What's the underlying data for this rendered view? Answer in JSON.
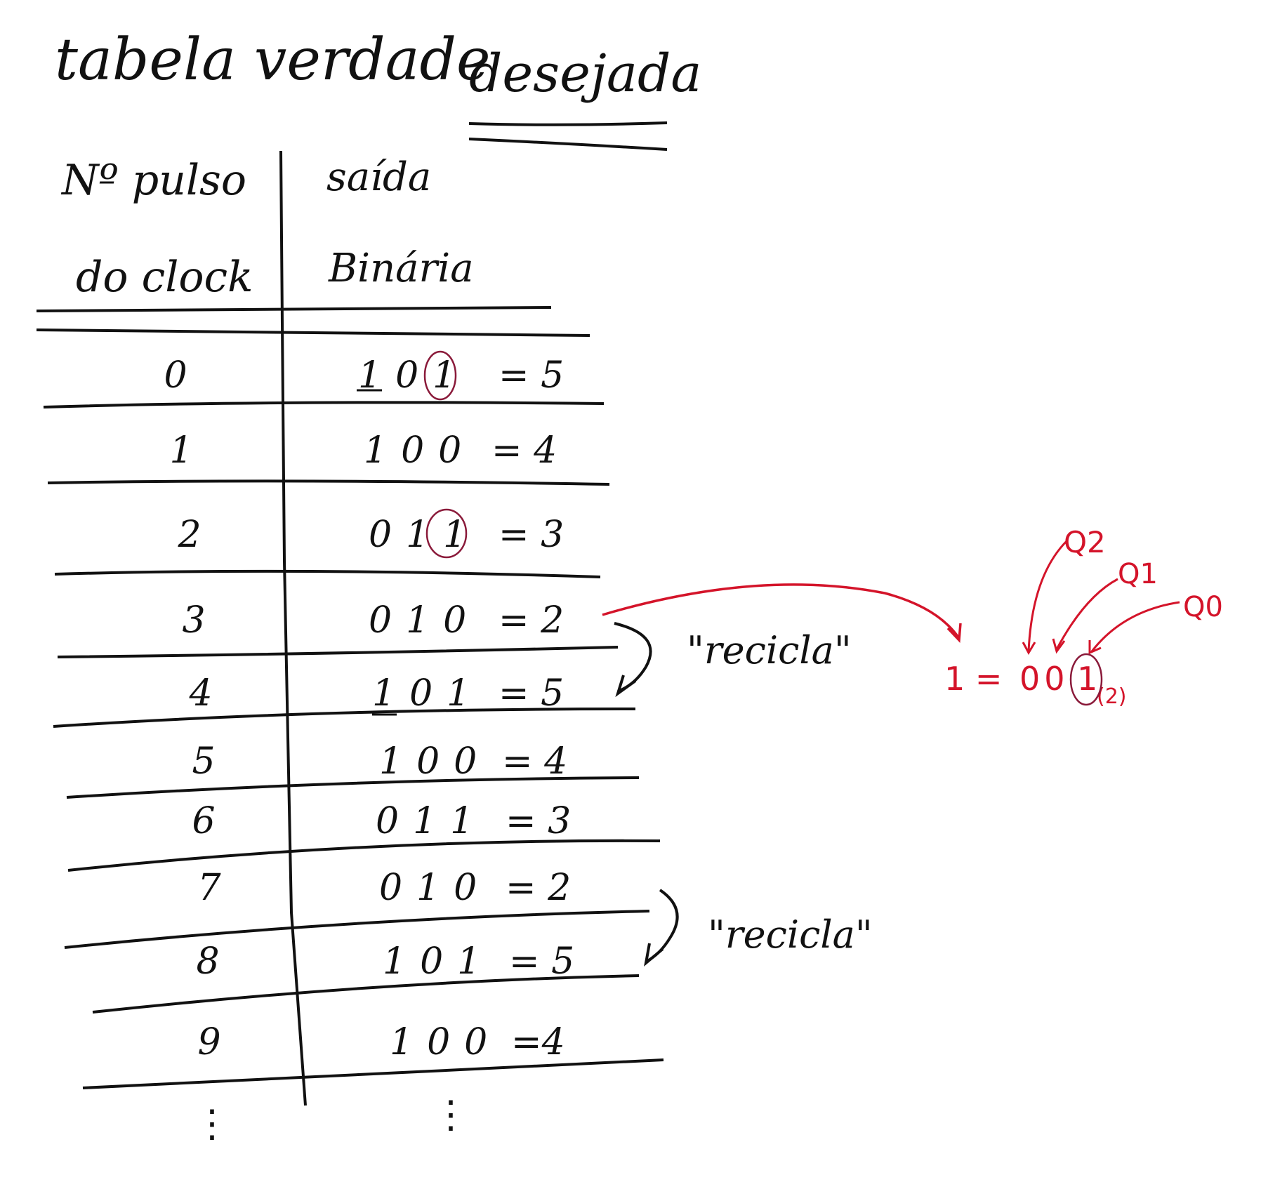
{
  "title": {
    "part1": "tabela verdade",
    "part2": "desejada"
  },
  "header": {
    "left": {
      "line1": "Nº pulso",
      "line2": "do clock"
    },
    "right": {
      "line1": "saída",
      "line2": "Binária"
    }
  },
  "rows": [
    {
      "pulse": "0",
      "binary": "101",
      "eq": "= 5"
    },
    {
      "pulse": "1",
      "binary": "100",
      "eq": "= 4"
    },
    {
      "pulse": "2",
      "binary": "011",
      "eq": "= 3"
    },
    {
      "pulse": "3",
      "binary": "010",
      "eq": "= 2"
    },
    {
      "pulse": "4",
      "binary": "101",
      "eq": "= 5"
    },
    {
      "pulse": "5",
      "binary": "100",
      "eq": "= 4"
    },
    {
      "pulse": "6",
      "binary": "011",
      "eq": "= 3"
    },
    {
      "pulse": "7",
      "binary": "010",
      "eq": "= 2"
    },
    {
      "pulse": "8",
      "binary": "101",
      "eq": "= 5"
    },
    {
      "pulse": "9",
      "binary": "100",
      "eq": "=4"
    }
  ],
  "notes": {
    "recicla_1": "\"recicla\"",
    "recicla_2": "\"recicla\""
  },
  "annotation": {
    "q2": "Q2",
    "q1": "Q1",
    "q0": "Q0",
    "equation_left": "1 =",
    "bits": "00",
    "bit_circled": "1",
    "subscript": "(2)"
  },
  "continuation": {
    "left": "⋮",
    "right": "⋮"
  },
  "colors": {
    "ink": "#111111",
    "annotation": "#d4142a"
  }
}
